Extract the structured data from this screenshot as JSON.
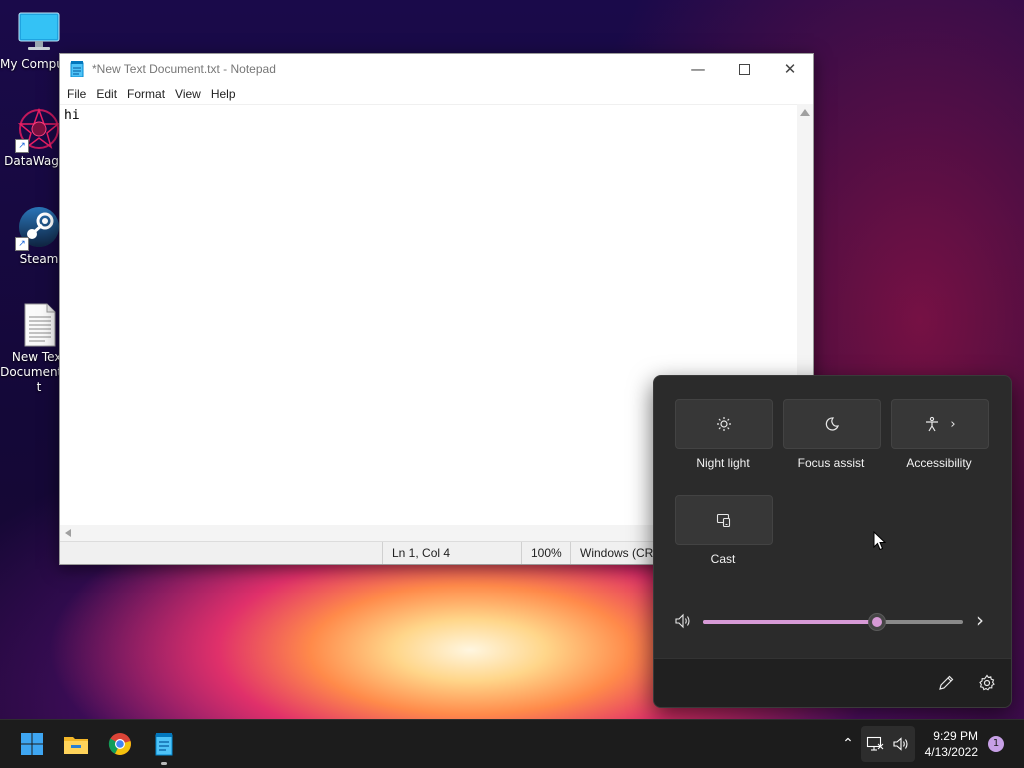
{
  "desktop": {
    "icons": [
      {
        "label": "My Computer",
        "icon": "monitor-icon"
      },
      {
        "label": "DataWagon",
        "icon": "datawagon-icon"
      },
      {
        "label": "Steam",
        "icon": "steam-icon"
      },
      {
        "label": "New Text Document.txt",
        "icon": "text-file-icon"
      }
    ]
  },
  "notepad": {
    "title": "*New Text Document.txt - Notepad",
    "menu": [
      "File",
      "Edit",
      "Format",
      "View",
      "Help"
    ],
    "content": "hi",
    "status": {
      "position": "Ln 1, Col 4",
      "zoom": "100%",
      "line_endings": "Windows (CRLF)"
    }
  },
  "quick_settings": {
    "tiles": [
      {
        "label": "Night light",
        "icon": "brightness-icon"
      },
      {
        "label": "Focus assist",
        "icon": "moon-icon"
      },
      {
        "label": "Accessibility",
        "icon": "accessibility-icon"
      },
      {
        "label": "Cast",
        "icon": "cast-icon"
      }
    ],
    "volume_level": 0.67,
    "accent_color": "#d79ad6"
  },
  "taskbar": {
    "time": "9:29 PM",
    "date": "4/13/2022",
    "notification_count": "1"
  }
}
